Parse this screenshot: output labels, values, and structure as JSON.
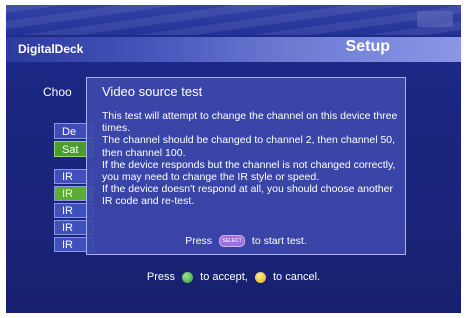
{
  "header": {
    "brand": "DigitalDeck",
    "title": "Setup"
  },
  "background": {
    "choose_label": "Choo",
    "options": [
      "De",
      "Sat"
    ],
    "ir_items": [
      "IR",
      "IR",
      "IR",
      "IR",
      "IR"
    ],
    "selected_ir_index": 1
  },
  "dialog": {
    "title": "Video source test",
    "paragraphs": [
      "This test will attempt to change the channel on this device three times.",
      "The channel should be changed to channel 2, then channel 50, then channel 100.",
      "If the device responds but the channel is not changed correctly, you may need to change the IR style or speed.",
      "If the device doesn't respond at all, you should choose another IR code and re-test."
    ],
    "press_prefix": "Press",
    "select_button_label": "SELECT",
    "press_suffix": "to start test."
  },
  "footer": {
    "press": "Press",
    "accept_text": "to accept,",
    "cancel_text": "to cancel."
  },
  "colors": {
    "select_button": "#a070e0",
    "accept_button": "#2e9a30",
    "cancel_button": "#e0a800"
  }
}
